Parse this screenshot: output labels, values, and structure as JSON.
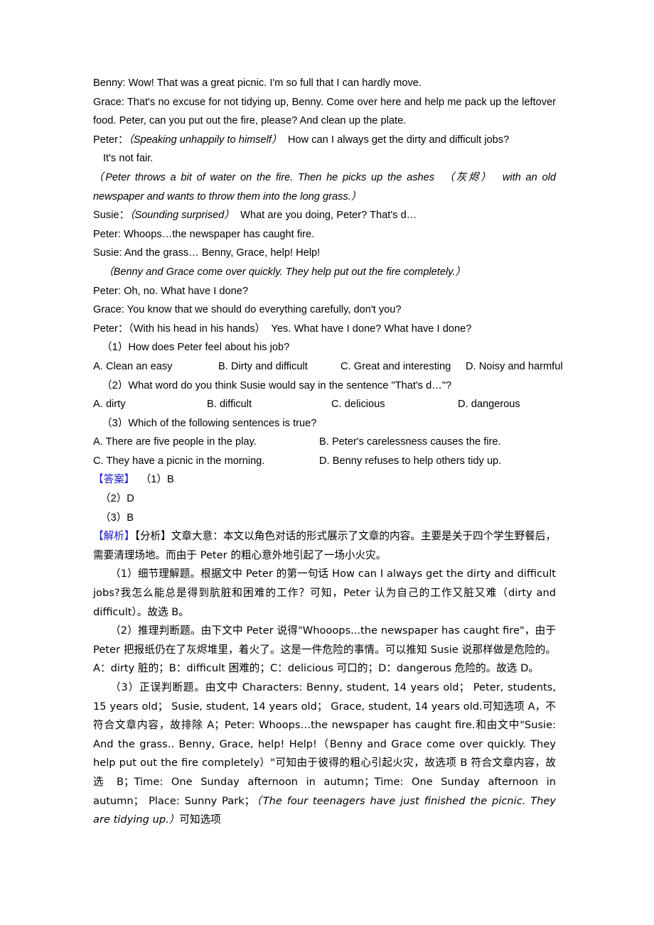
{
  "document": {
    "type": "english-reading-comprehension-worksheet",
    "colors": {
      "text": "#000000",
      "marker_blue": "#1f1fc8",
      "page_background": "#ffffff"
    },
    "passage": {
      "lines": [
        {
          "id": "benny-1",
          "text": "Benny: Wow! That was a great picnic. I'm so full that I can hardly move."
        },
        {
          "id": "grace-1",
          "text": "Grace: That's no excuse for not tidying up, Benny. Come over here and help me pack up the leftover food. Peter, can you put out the fire, please? And clean up the plate."
        },
        {
          "id": "peter-1-speaker",
          "text": "Peter："
        },
        {
          "id": "peter-1-stage",
          "text": "（Speaking unhappily to himself）"
        },
        {
          "id": "peter-1-rest",
          "text": "How can I always get the dirty and difficult jobs?"
        },
        {
          "id": "peter-1-cont",
          "text": "It's not fair."
        },
        {
          "id": "stage-2a",
          "text": "（Peter throws a bit of water on the fire. Then he picks up the ashes"
        },
        {
          "id": "stage-2-gloss",
          "text": "（灰烬）"
        },
        {
          "id": "stage-2b",
          "text": "with an old newspaper and wants to throw them into the long grass.）"
        },
        {
          "id": "susie-1-speaker",
          "text": "Susie："
        },
        {
          "id": "susie-1-stage",
          "text": "（Sounding surprised）"
        },
        {
          "id": "susie-1-rest",
          "text": "What are you doing, Peter? That's d…"
        },
        {
          "id": "peter-2",
          "text": "Peter: Whoops…the newspaper has caught fire."
        },
        {
          "id": "susie-2",
          "text": "Susie: And the grass… Benny, Grace, help! Help!"
        },
        {
          "id": "stage-3",
          "text": "（Benny and Grace come over quickly. They help put out the fire completely.）"
        },
        {
          "id": "peter-3",
          "text": "Peter: Oh, no. What have I done?"
        },
        {
          "id": "grace-2",
          "text": "Grace: You know that we should do everything carefully, don't you?"
        },
        {
          "id": "peter-4-speaker",
          "text": "Peter："
        },
        {
          "id": "peter-4-stage",
          "text": "（With his head in his hands）"
        },
        {
          "id": "peter-4-rest",
          "text": "Yes. What have I done? What have I done?"
        }
      ]
    },
    "questions": [
      {
        "number": "（1）",
        "stem": "How does Peter feel about his job?",
        "options": [
          "A. Clean an easy",
          "B. Dirty and difficult",
          "C. Great and interesting",
          "D. Noisy and harmful"
        ],
        "layout": "four-across"
      },
      {
        "number": "（2）",
        "stem": "What word do you think Susie would say in the sentence \"That's d…\"?",
        "options": [
          "A. dirty",
          "B. difficult",
          "C. delicious",
          "D. dangerous"
        ],
        "layout": "four-across"
      },
      {
        "number": "（3）",
        "stem": "Which of the following sentences is true?",
        "options": [
          "A. There are five people in the play.",
          "B. Peter's carelessness causes the fire.",
          "C. They have a picnic in the morning.",
          "D. Benny refuses to help others tidy up."
        ],
        "layout": "two-by-two"
      }
    ],
    "answer_section": {
      "marker": "【答案】",
      "lines": [
        "（1）B",
        "（2）D",
        "（3）B"
      ]
    },
    "analysis_section": {
      "marker": "【解析】",
      "sub_marker": "【分析】",
      "overview": "文章大意：本文以角色对话的形式展示了文章的内容。主要是关于四个学生野餐后，需要清理场地。而由于 Peter 的粗心意外地引起了一场小火灾。",
      "items": [
        {
          "number": "（1）",
          "text": "细节理解题。根据文中 Peter 的第一句话 How can I always get the dirty and difficult jobs?我怎么能总是得到肮脏和困难的工作？可知，Peter 认为自己的工作又脏又难（dirty and difficult）。故选 B。"
        },
        {
          "number": "（2）",
          "text": "推理判断题。由下文中 Peter 说得\"Whooops...the newspaper has caught fire\"，由于 Peter 把报纸仍在了灰烬堆里，着火了。这是一件危险的事情。可以推知 Susie 说那样做是危险的。A：dirty 脏的；B：difficult 困难的；C：delicious 可口的；D：dangerous 危险的。故选 D。"
        },
        {
          "number": "（3）",
          "head": "正误判断题。由文中 Characters: Benny, student, 14 years old； Peter, students, 15 years old； Susie, student, 14 years old； Grace, student, 14 years old.可知选项 A，不符合文章内容，故排除 A；Peter: Whoops…the newspaper has caught fire.和由文中\"Susie: And the grass.. Benny, Grace, help! Help!（Benny and Grace come over quickly. They help put out the fire completely）\"可知由于彼得的粗心引起火灾，故选项 B 符合文章内容，故选 B；Time: One Sunday afternoon in autumn；Time: One Sunday afternoon in autumn； Place: Sunny Park；",
          "italic_quote": "（The four teenagers have just finished the picnic. They are tidying up.）",
          "tail": "可知选项"
        }
      ]
    }
  }
}
